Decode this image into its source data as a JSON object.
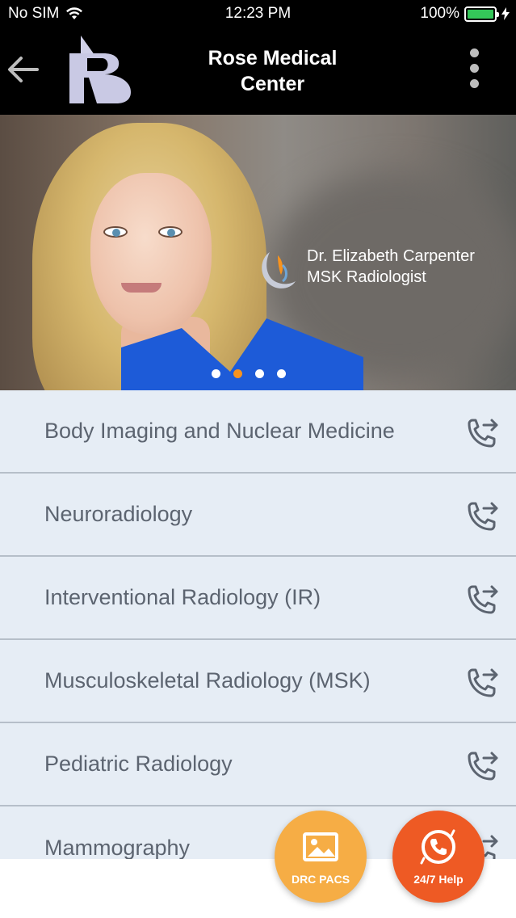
{
  "status_bar": {
    "carrier": "No SIM",
    "time": "12:23 PM",
    "battery": "100%"
  },
  "app_bar": {
    "title_line1": "Rose Medical",
    "title_line2": "Center"
  },
  "hero": {
    "caption_line1": "Dr. Elizabeth Carpenter",
    "caption_line2": "MSK Radiologist",
    "slide_count": 4,
    "active_slide": 2
  },
  "list": {
    "items": [
      {
        "label": "Body Imaging and Nuclear Medicine"
      },
      {
        "label": "Neuroradiology"
      },
      {
        "label": "Interventional Radiology (IR)"
      },
      {
        "label": "Musculoskeletal Radiology (MSK)"
      },
      {
        "label": "Pediatric Radiology"
      },
      {
        "label": "Mammography"
      }
    ]
  },
  "actions": {
    "pacs_label": "DRC PACS",
    "help_label": "24/7 Help"
  },
  "colors": {
    "accent_orange": "#f7931e",
    "pacs_fab": "#f6ad45",
    "help_fab": "#ee5a24",
    "list_bg": "#e6edf5",
    "list_text": "#5c6470"
  }
}
